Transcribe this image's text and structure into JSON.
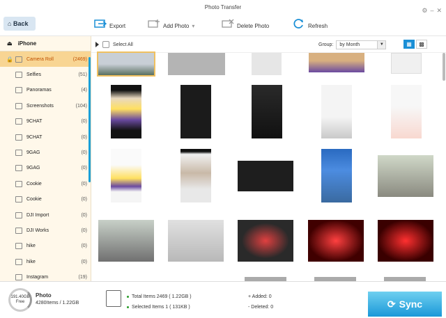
{
  "window": {
    "title": "Photo Transfer"
  },
  "toolbar": {
    "back_label": "Back",
    "export_label": "Export",
    "add_photo_label": "Add Photo",
    "delete_photo_label": "Delete Photo",
    "refresh_label": "Refresh"
  },
  "sidebar": {
    "device": "iPhone",
    "items": [
      {
        "label": "Camera Roll",
        "count": "(2469)",
        "icon": "camera-icon"
      },
      {
        "label": "Selfies",
        "count": "(51)",
        "icon": "selfie-icon"
      },
      {
        "label": "Panoramas",
        "count": "(4)",
        "icon": "panorama-icon"
      },
      {
        "label": "Screenshots",
        "count": "(104)",
        "icon": "screenshot-icon"
      },
      {
        "label": "9CHAT",
        "count": "(0)",
        "icon": "album-icon"
      },
      {
        "label": "9CHAT",
        "count": "(0)",
        "icon": "album-icon"
      },
      {
        "label": "9GAG",
        "count": "(0)",
        "icon": "album-icon"
      },
      {
        "label": "9GAG",
        "count": "(0)",
        "icon": "album-icon"
      },
      {
        "label": "Cookie",
        "count": "(0)",
        "icon": "album-icon"
      },
      {
        "label": "Cookie",
        "count": "(0)",
        "icon": "album-icon"
      },
      {
        "label": "DJI Import",
        "count": "(0)",
        "icon": "album-icon"
      },
      {
        "label": "DJI Works",
        "count": "(0)",
        "icon": "album-icon"
      },
      {
        "label": "hike",
        "count": "(0)",
        "icon": "album-icon"
      },
      {
        "label": "hike",
        "count": "(0)",
        "icon": "album-icon"
      },
      {
        "label": "Instagram",
        "count": "(19)",
        "icon": "album-icon"
      }
    ]
  },
  "filter": {
    "select_all_label": "Select All",
    "group_label": "Group:",
    "group_value": "by Month"
  },
  "footer": {
    "free_space": "191.40GB",
    "free_label": "Free",
    "category": "Photo",
    "items_info": "4280Items / 1.22GB",
    "total_items": "Total Items 2469 ( 1.22GB )",
    "selected_items": "Selected Items 1 ( 131KB )",
    "added": "+ Added: 0",
    "deleted": "- Deleted: 0",
    "sync_label": "Sync"
  },
  "colors": {
    "accent": "#1a98d8",
    "active_bg": "#f8d593",
    "sidebar_bg": "#fff8ea"
  }
}
